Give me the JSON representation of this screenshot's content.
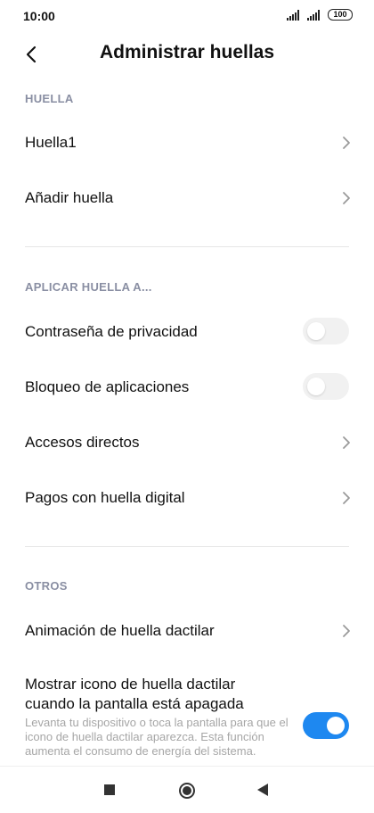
{
  "status_bar": {
    "time": "10:00",
    "battery": "100"
  },
  "header": {
    "title": "Administrar huellas"
  },
  "sections": {
    "huella": {
      "title": "HUELLA",
      "items": [
        {
          "label": "Huella1"
        },
        {
          "label": "Añadir huella"
        }
      ]
    },
    "aplicar": {
      "title": "APLICAR HUELLA A...",
      "items": [
        {
          "label": "Contraseña de privacidad",
          "toggle": "off"
        },
        {
          "label": "Bloqueo de aplicaciones",
          "toggle": "off"
        },
        {
          "label": "Accesos directos"
        },
        {
          "label": "Pagos con huella digital"
        }
      ]
    },
    "otros": {
      "title": "OTROS",
      "items": [
        {
          "label": "Animación de huella dactilar"
        },
        {
          "label_line1": "Mostrar icono de huella dactilar",
          "label_line2": "cuando la pantalla está apagada",
          "description": "Levanta tu dispositivo o toca la pantalla para que el icono de huella dactilar aparezca. Esta función aumenta el consumo de energía del sistema.",
          "toggle": "on"
        }
      ]
    }
  },
  "colors": {
    "accent": "#1e88f0",
    "section_header": "#8a8fa3",
    "description": "#a6a6a6"
  },
  "icons": [
    "back-arrow-icon",
    "chevron-right-icon",
    "signal-icon",
    "battery-icon",
    "recents-square-icon",
    "home-circle-icon",
    "back-triangle-icon"
  ]
}
